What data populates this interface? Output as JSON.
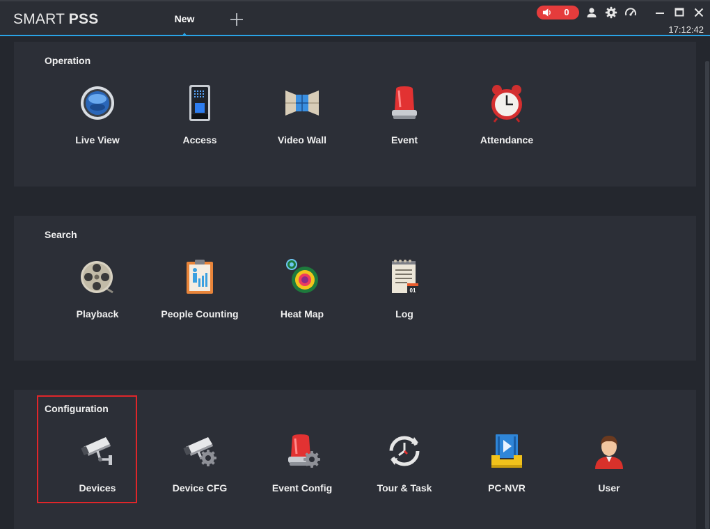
{
  "app": {
    "brand_light": "SMART",
    "brand_bold": "PSS",
    "tab_label": "New",
    "alarm_count": "0",
    "time": "17:12:42",
    "accent_color": "#2aa3e6",
    "alarm_color": "#e53c3c"
  },
  "sections": {
    "operation": {
      "title": "Operation",
      "items": [
        {
          "label": "Live View",
          "icon": "camera-lens-icon"
        },
        {
          "label": "Access",
          "icon": "access-control-icon"
        },
        {
          "label": "Video Wall",
          "icon": "video-wall-icon"
        },
        {
          "label": "Event",
          "icon": "alarm-light-icon"
        },
        {
          "label": "Attendance",
          "icon": "alarm-clock-icon"
        }
      ]
    },
    "search": {
      "title": "Search",
      "items": [
        {
          "label": "Playback",
          "icon": "film-reel-icon"
        },
        {
          "label": "People Counting",
          "icon": "people-counting-icon"
        },
        {
          "label": "Heat Map",
          "icon": "heat-map-icon"
        },
        {
          "label": "Log",
          "icon": "log-notepad-icon"
        }
      ]
    },
    "configuration": {
      "title": "Configuration",
      "items": [
        {
          "label": "Devices",
          "icon": "cctv-camera-icon"
        },
        {
          "label": "Device CFG",
          "icon": "camera-gear-icon"
        },
        {
          "label": "Event Config",
          "icon": "alarm-gear-icon"
        },
        {
          "label": "Tour & Task",
          "icon": "tour-clock-icon"
        },
        {
          "label": "PC-NVR",
          "icon": "pc-nvr-icon"
        },
        {
          "label": "User",
          "icon": "user-avatar-icon"
        }
      ]
    }
  }
}
